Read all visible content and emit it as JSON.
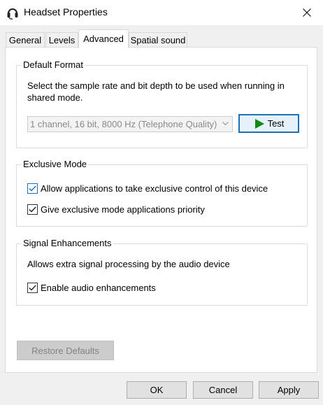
{
  "window": {
    "title": "Headset Properties",
    "icon": "headset-icon",
    "close_icon": "close-icon"
  },
  "tabs": [
    {
      "label": "General",
      "active": false
    },
    {
      "label": "Levels",
      "active": false
    },
    {
      "label": "Advanced",
      "active": true
    },
    {
      "label": "Spatial sound",
      "active": false
    }
  ],
  "default_format": {
    "title": "Default Format",
    "description": "Select the sample rate and bit depth to be used when running in shared mode.",
    "selected_format": "1 channel, 16 bit, 8000 Hz (Telephone Quality)",
    "test_label": "Test",
    "test_icon": "play-icon",
    "play_color": "#0f8a0f"
  },
  "exclusive_mode": {
    "title": "Exclusive Mode",
    "allow_label": "Allow applications to take exclusive control of this device",
    "allow_checked": true,
    "priority_label": "Give exclusive mode applications priority",
    "priority_checked": true
  },
  "signal_enhancements": {
    "title": "Signal Enhancements",
    "description": "Allows extra signal processing by the audio device",
    "enable_label": "Enable audio enhancements",
    "enable_checked": true
  },
  "buttons": {
    "restore_defaults": "Restore Defaults",
    "ok": "OK",
    "cancel": "Cancel",
    "apply": "Apply"
  },
  "colors": {
    "accent": "#1e6fb5",
    "panel_bg": "#ffffff",
    "window_bg": "#f0f0f0"
  }
}
